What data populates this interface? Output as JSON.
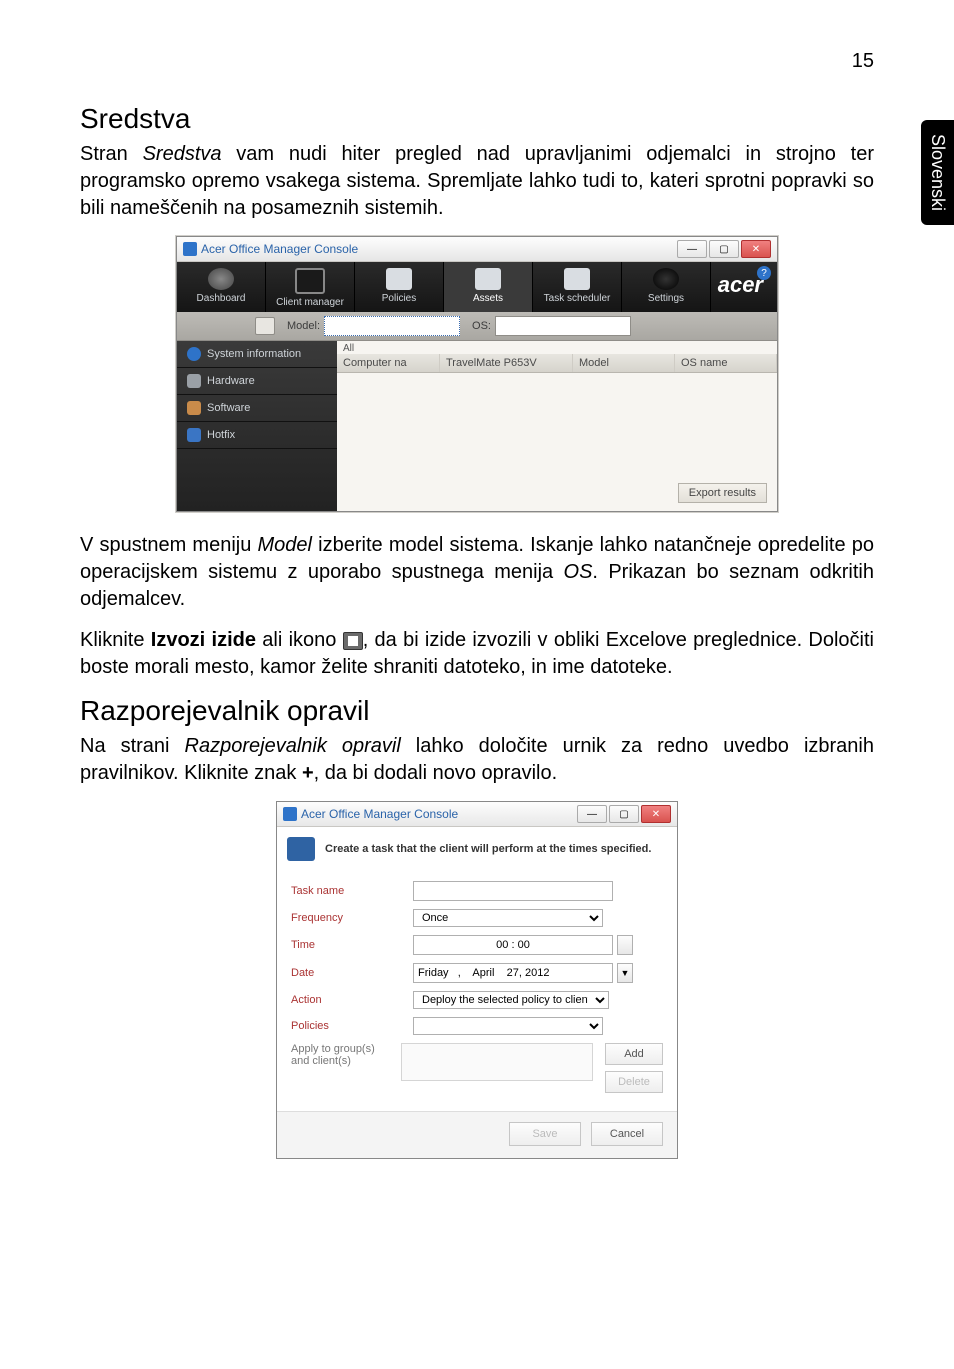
{
  "page_number": "15",
  "side_tab": "Slovenski",
  "s1": {
    "heading": "Sredstva",
    "p1_a": "Stran ",
    "p1_it": "Sredstva",
    "p1_b": " vam nudi hiter pregled nad upravljanimi odjemalci in strojno ter programsko opremo vsakega sistema. Spremljate lahko tudi to, kateri sprotni popravki so bili nameščenih na posameznih sistemih.",
    "p2_a": "V spustnem meniju ",
    "p2_it1": "Model",
    "p2_b": " izberite model sistema. Iskanje lahko natančneje opredelite po operacijskem sistemu z uporabo spustnega menija ",
    "p2_it2": "OS",
    "p2_c": ". Prikazan bo seznam odkritih odjemalcev.",
    "p3_a": "Kliknite ",
    "p3_bold": "Izvozi izide",
    "p3_b": " ali ikono ",
    "p3_c": ", da bi izide izvozili v obliki Excelove preglednice. Določiti boste morali mesto, kamor želite shraniti datoteko, in ime datoteke."
  },
  "s2": {
    "heading": "Razporejevalnik opravil",
    "p1_a": "Na strani ",
    "p1_it": "Razporejevalnik opravil",
    "p1_b": " lahko določite urnik za redno uvedbo izbranih pravilnikov. Kliknite znak ",
    "p1_bold": "+",
    "p1_c": ", da bi dodali novo opravilo."
  },
  "win1": {
    "title": "Acer Office Manager Console",
    "tabs": {
      "dashboard": "Dashboard",
      "client_manager": "Client manager",
      "policies": "Policies",
      "assets": "Assets",
      "task_scheduler": "Task scheduler",
      "settings": "Settings"
    },
    "brand": "acer",
    "help": "?",
    "filters": {
      "model_label": "Model:",
      "os_label": "OS:"
    },
    "leftnav": {
      "system_info": "System information",
      "hardware": "Hardware",
      "software": "Software",
      "hotfix": "Hotfix"
    },
    "all_label": "All",
    "columns": {
      "computer": "Computer na",
      "model": "TravelMate P653V",
      "model_h": "Model",
      "os_h": "OS name"
    },
    "export_btn": "Export results"
  },
  "win2": {
    "title": "Acer Office Manager Console",
    "head": "Create a task that the client will perform at the times specified.",
    "labels": {
      "task_name": "Task name",
      "frequency": "Frequency",
      "time": "Time",
      "date": "Date",
      "action": "Action",
      "policies": "Policies",
      "apply": "Apply to group(s) and client(s)"
    },
    "values": {
      "frequency": "Once",
      "time": "00 : 00",
      "date": "Friday   ,    April    27, 2012",
      "action": "Deploy the selected policy to client(s)"
    },
    "buttons": {
      "add": "Add",
      "delete": "Delete",
      "save": "Save",
      "cancel": "Cancel"
    }
  }
}
